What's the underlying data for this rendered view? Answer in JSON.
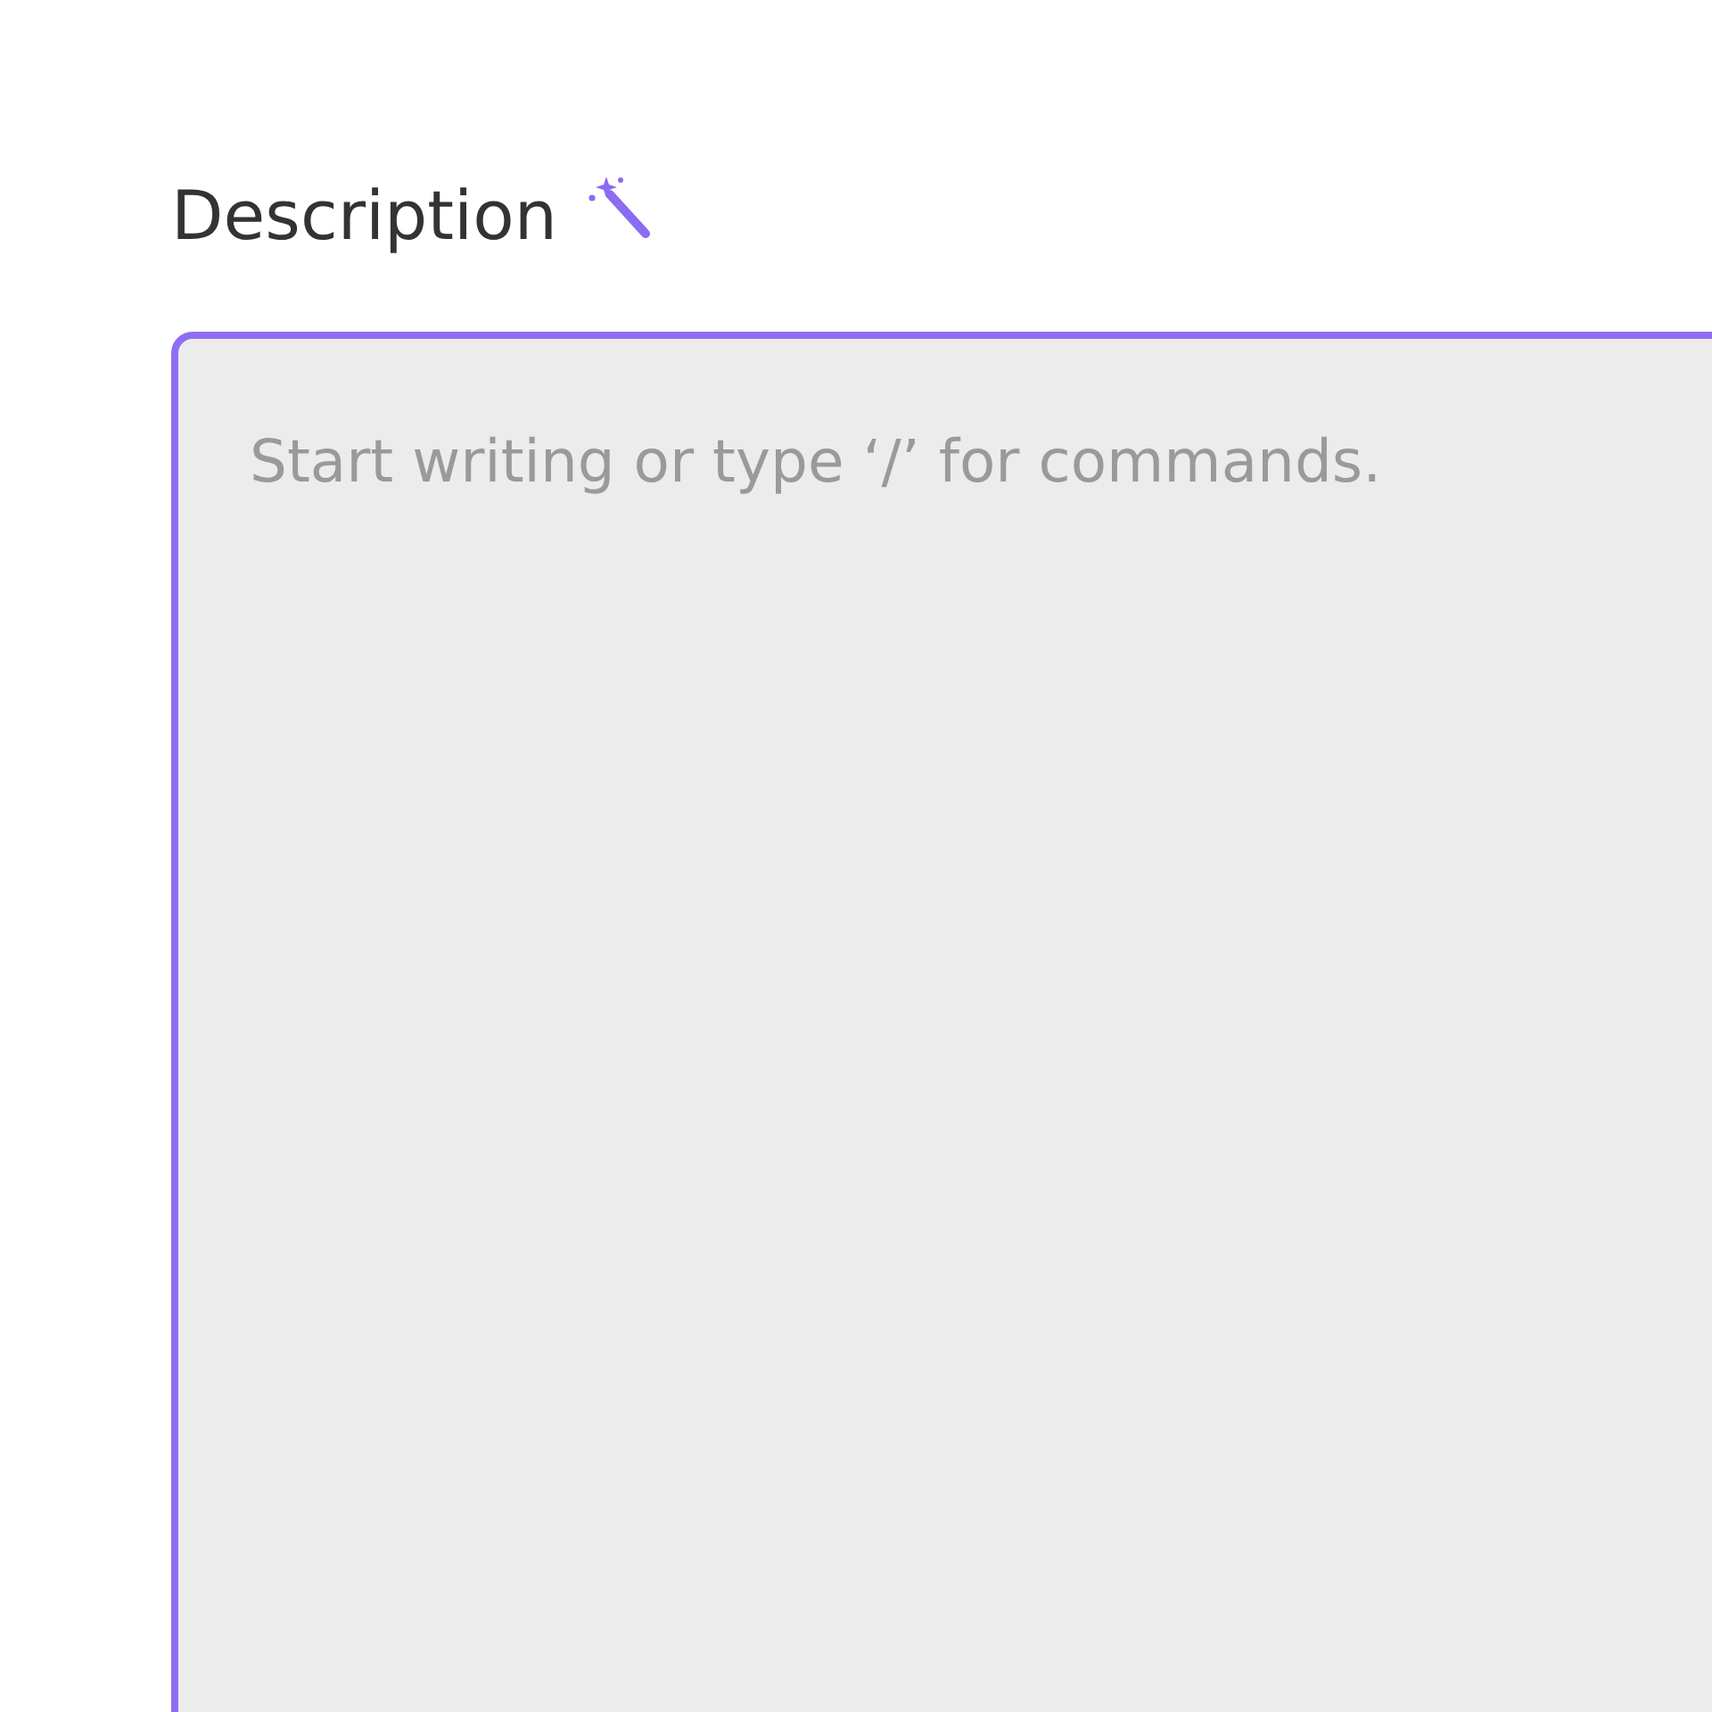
{
  "description_field": {
    "label": "Description",
    "placeholder": "Start writing or type ‘/’ for commands.",
    "focused": true
  }
}
